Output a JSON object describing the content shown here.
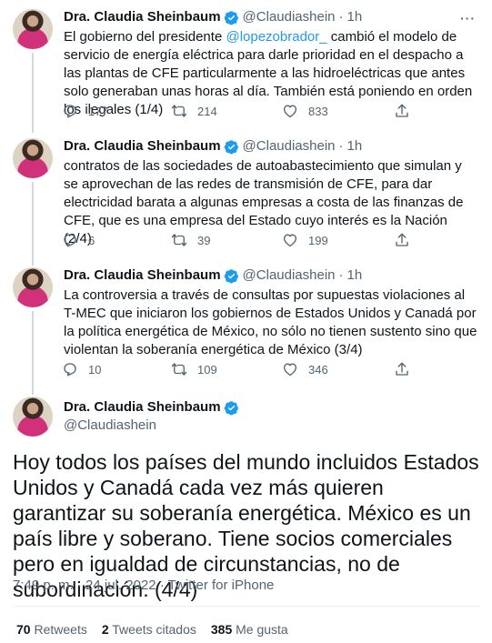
{
  "author": {
    "name": "Dra. Claudia Sheinbaum",
    "handle": "@Claudiashein"
  },
  "separator": "·",
  "more_glyph": "···",
  "thread": [
    {
      "time": "1h",
      "text_before": "El gobierno del presidente ",
      "mention": "@lopezobrador_",
      "text_after": " cambió el modelo de servicio de energía eléctrica para darle prioridad en el despacho a las plantas de CFE particularmente a las hidroeléctricas que antes solo generaban unas horas al día. También está poniendo en orden los ilegales (1/4)",
      "replies": "177",
      "retweets": "214",
      "likes": "833"
    },
    {
      "time": "1h",
      "text": "contratos de las sociedades de autoabastecimiento que simulan y se aprovechan de las redes de transmisión de CFE, para dar electricidad barata a algunas empresas a costa de las finanzas de CFE, que es una empresa del Estado cuyo interés es la Nación (2/4)",
      "replies": "6",
      "retweets": "39",
      "likes": "199"
    },
    {
      "time": "1h",
      "text": "La controversia a través de consultas por supuestas violaciones al T-MEC que iniciaron los gobiernos de Estados Unidos y Canadá por la política energética de México, no sólo no tienen sustento sino que violentan la soberanía energética de México (3/4)",
      "replies": "10",
      "retweets": "109",
      "likes": "346"
    }
  ],
  "main_tweet": {
    "text": "Hoy todos los países del mundo incluidos Estados Unidos y Canadá cada vez más quieren garantizar su soberanía energética. México es un país libre y soberano. Tiene socios comerciales pero en igualdad de circunstancias, no de subordinación. (4/4)",
    "timestamp": "7:49 p. m. · 24 jul. 2022 · Twitter for iPhone",
    "retweets_count": "70",
    "retweets_label": "Retweets",
    "quotes_count": "2",
    "quotes_label": "Tweets citados",
    "likes_count": "385",
    "likes_label": "Me gusta"
  },
  "colors": {
    "accent": "#1d9bf0",
    "muted": "#536471",
    "text": "#0f1419"
  }
}
